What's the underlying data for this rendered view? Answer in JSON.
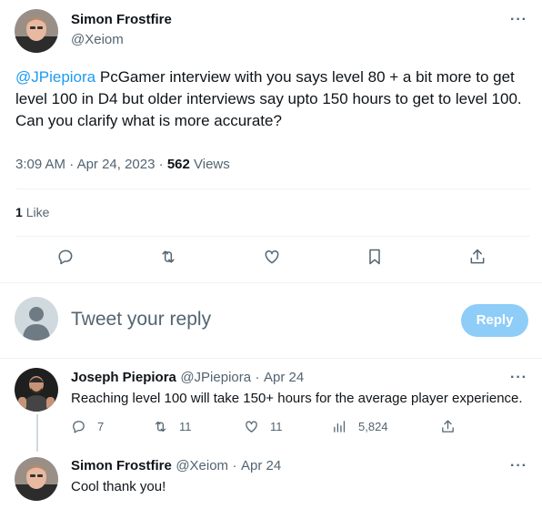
{
  "main_tweet": {
    "author_name": "Simon Frostfire",
    "handle": "@Xeiom",
    "mention": "@JPiepiora",
    "text": " PcGamer interview with you says level 80 + a bit more to get level 100 in D4 but older interviews say upto 150 hours to get to level 100.\nCan you clarify what is more accurate?",
    "time": "3:09 AM",
    "date": "Apr 24, 2023",
    "views_count": "562",
    "views_label": "Views",
    "likes_count": "1",
    "likes_label": "Like"
  },
  "reply_box": {
    "placeholder": "Tweet your reply",
    "button_label": "Reply"
  },
  "replies": [
    {
      "author_name": "Joseph Piepiora",
      "handle": "@JPiepiora",
      "date": "Apr 24",
      "text": "Reaching level 100 will take 150+ hours for the average player experience.",
      "reply_count": "7",
      "retweet_count": "11",
      "like_count": "11",
      "view_count": "5,824"
    },
    {
      "author_name": "Simon Frostfire",
      "handle": "@Xeiom",
      "date": "Apr 24",
      "text": "Cool thank you!"
    }
  ],
  "separator": "·",
  "more_glyph": "···",
  "colors": {
    "accent": "#1d9bf0",
    "muted": "#536471",
    "reply_button": "#8ecdf8"
  }
}
